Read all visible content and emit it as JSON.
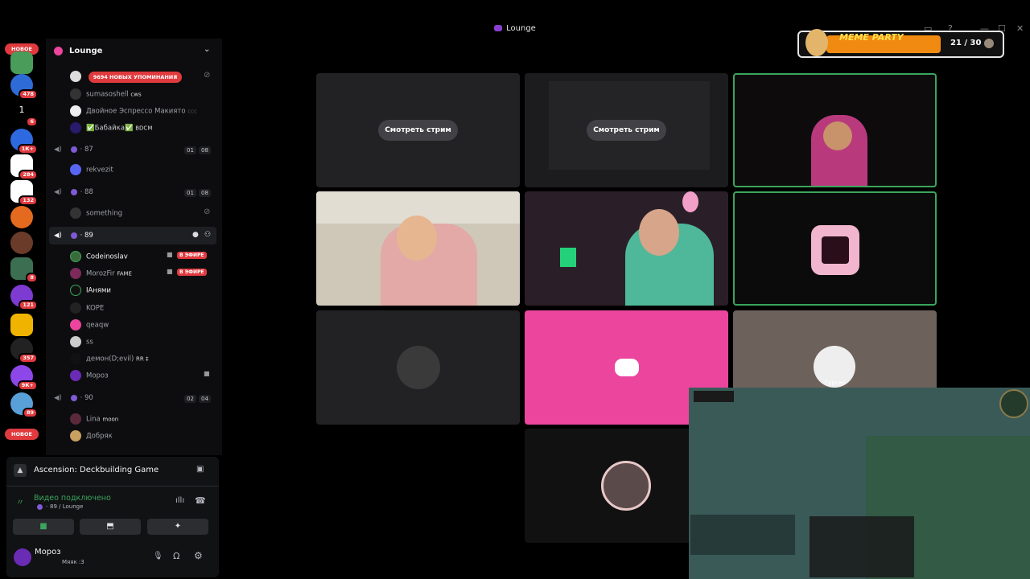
{
  "window": {
    "title": "Lounge"
  },
  "rail": {
    "top_pill": "НОВОЕ",
    "bottom_pill": "НОВОЕ",
    "badges": [
      "478",
      "6",
      "1К+",
      "284",
      "132",
      "8",
      "121",
      "357",
      "9К+",
      "89"
    ],
    "first_number": "1"
  },
  "channel_panel": {
    "server_name": "Lounge",
    "mentions_badge": "9694 НОВЫХ УПОМИНАНИЯ",
    "members_top": [
      {
        "name": "sumasoshell",
        "tag": "cws"
      },
      {
        "name": "Двойное Эспрессо Макиято",
        "tag": "ccc"
      },
      {
        "name": "✅Бабайка✅",
        "tag": "BDCM"
      }
    ],
    "channels": [
      {
        "name": "87",
        "counts": [
          "01",
          "08"
        ],
        "members": [
          {
            "name": "rekvezit"
          }
        ]
      },
      {
        "name": "88",
        "counts": [
          "01",
          "08"
        ],
        "members": [
          {
            "name": "something"
          }
        ]
      },
      {
        "name": "89",
        "members": [
          {
            "name": "Codeinoslav",
            "badge": "В ЭФИРЕ"
          },
          {
            "name": "MorozFir",
            "tag": "FAME",
            "badge": "В ЭФИРЕ"
          },
          {
            "name": "IАнями"
          },
          {
            "name": "KOPE"
          },
          {
            "name": "qeaqw"
          },
          {
            "name": "ss"
          },
          {
            "name": "демон(D;evil)",
            "tag": "RR ‡"
          },
          {
            "name": "Мороз"
          }
        ]
      },
      {
        "name": "90",
        "counts": [
          "02",
          "04"
        ],
        "members": [
          {
            "name": "Lina",
            "tag": "moon"
          },
          {
            "name": "Добряк"
          }
        ]
      }
    ]
  },
  "voice_panel": {
    "activity": "Ascension: Deckbuilding Game",
    "status": "Видео подключено",
    "location": "89 / Lounge",
    "user_name": "Мороз",
    "user_status": "Мяяк :3"
  },
  "grid": {
    "watch_label": "Смотреть стрим",
    "user_label": "Гурген"
  },
  "meme_party": {
    "label": "MEME PARTY",
    "progress": "21 / 30",
    "fraction": 0.7
  },
  "colors": {
    "accent": "#eb459e",
    "speaking": "#3ba55d",
    "danger": "#e03a3e",
    "blurple": "#5865f2"
  }
}
